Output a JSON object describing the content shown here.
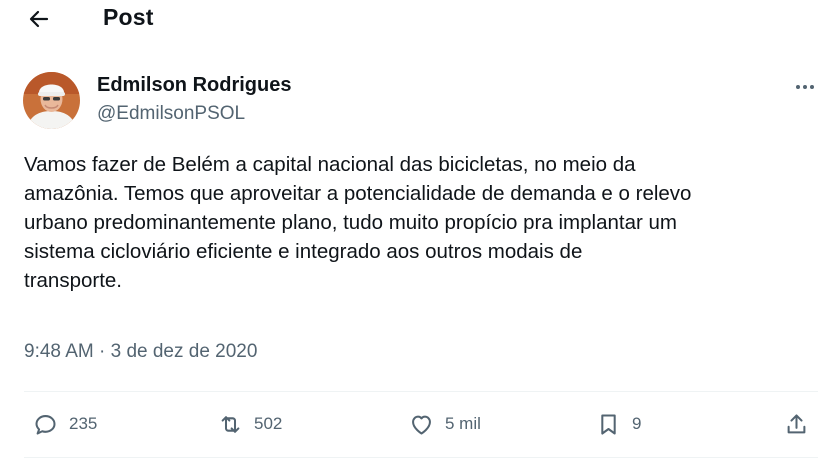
{
  "header": {
    "title": "Post",
    "back_icon": "arrow-left-icon"
  },
  "author": {
    "display_name": "Edmilson Rodrigues",
    "handle": "@EdmilsonPSOL",
    "more_icon": "more-horizontal-icon"
  },
  "tweet": {
    "text": "Vamos fazer de Belém a capital nacional das bicicletas, no meio da\namazônia. Temos que aproveitar a potencialidade de demanda e o relevo\nurbano predominantemente plano, tudo muito propício pra implantar um\nsistema cicloviário eficiente e integrado aos outros modais de\ntransporte.",
    "timestamp": "9:48 AM · 3 de dez de 2020"
  },
  "actions": {
    "replies": "235",
    "retweets": "502",
    "likes": "5 mil",
    "bookmarks": "9"
  },
  "colors": {
    "text_primary": "#0f1419",
    "text_secondary": "#536471",
    "divider": "#eff3f4"
  }
}
